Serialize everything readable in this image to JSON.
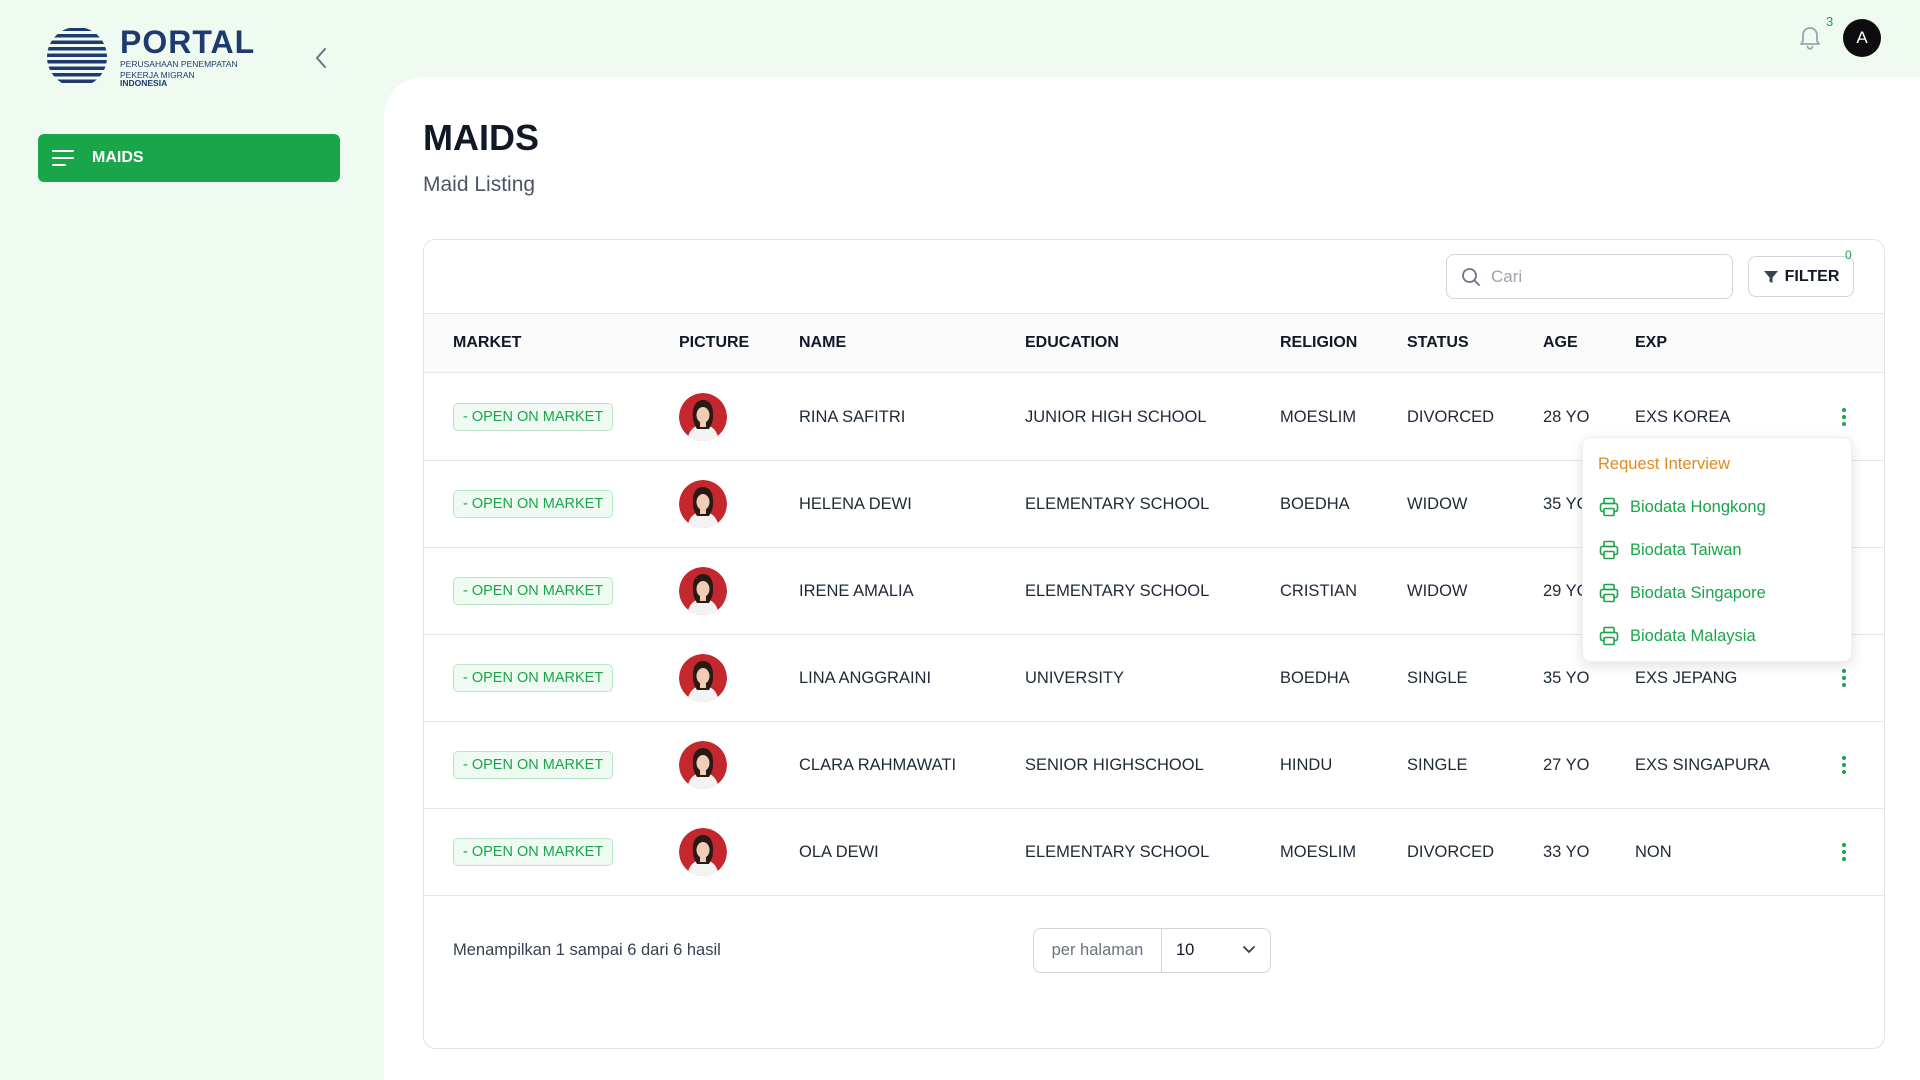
{
  "brand": {
    "title": "PORTAL",
    "subtitle_line1": "PERUSAHAAN PENEMPATAN",
    "subtitle_line2": "PEKERJA MIGRAN",
    "subtitle_line3": "INDONESIA"
  },
  "sidebar": {
    "items": [
      {
        "label": "MAIDS",
        "icon": "menu-lines-icon",
        "active": true
      }
    ]
  },
  "topbar": {
    "notification_count": "3",
    "avatar_initial": "A"
  },
  "page": {
    "title": "MAIDS",
    "subtitle": "Maid Listing"
  },
  "toolbar": {
    "search_placeholder": "Cari",
    "filter_label": "FILTER",
    "filter_count": "0"
  },
  "table": {
    "columns": [
      "MARKET",
      "PICTURE",
      "NAME",
      "EDUCATION",
      "RELIGION",
      "STATUS",
      "AGE",
      "EXP"
    ],
    "rows": [
      {
        "market": "- OPEN ON MARKET",
        "name": "RINA SAFITRI",
        "education": "JUNIOR HIGH SCHOOL",
        "religion": "MOESLIM",
        "status": "DIVORCED",
        "age": "28 YO",
        "exp": "EXS KOREA"
      },
      {
        "market": "- OPEN ON MARKET",
        "name": "HELENA DEWI",
        "education": "ELEMENTARY SCHOOL",
        "religion": "BOEDHA",
        "status": "WIDOW",
        "age": "35 YO",
        "exp": ""
      },
      {
        "market": "- OPEN ON MARKET",
        "name": "IRENE AMALIA",
        "education": "ELEMENTARY SCHOOL",
        "religion": "CRISTIAN",
        "status": "WIDOW",
        "age": "29 YO",
        "exp": ""
      },
      {
        "market": "- OPEN ON MARKET",
        "name": "LINA ANGGRAINI",
        "education": "UNIVERSITY",
        "religion": "BOEDHA",
        "status": "SINGLE",
        "age": "35 YO",
        "exp": "EXS JEPANG"
      },
      {
        "market": "- OPEN ON MARKET",
        "name": "CLARA RAHMAWATI",
        "education": "SENIOR HIGHSCHOOL",
        "religion": "HINDU",
        "status": "SINGLE",
        "age": "27 YO",
        "exp": "EXS SINGAPURA"
      },
      {
        "market": "- OPEN ON MARKET",
        "name": "OLA DEWI",
        "education": "ELEMENTARY SCHOOL",
        "religion": "MOESLIM",
        "status": "DIVORCED",
        "age": "33 YO",
        "exp": "NON"
      }
    ]
  },
  "footer": {
    "summary": "Menampilkan 1 sampai 6 dari 6 hasil",
    "per_page_label": "per halaman",
    "per_page_value": "10"
  },
  "row_menu": {
    "first": "Request Interview",
    "items": [
      "Biodata Hongkong",
      "Biodata Taiwan",
      "Biodata Singapore",
      "Biodata Malaysia"
    ]
  },
  "colors": {
    "primary": "#1aa54a",
    "accent_orange": "#e08a1e",
    "background": "#effbf1"
  }
}
